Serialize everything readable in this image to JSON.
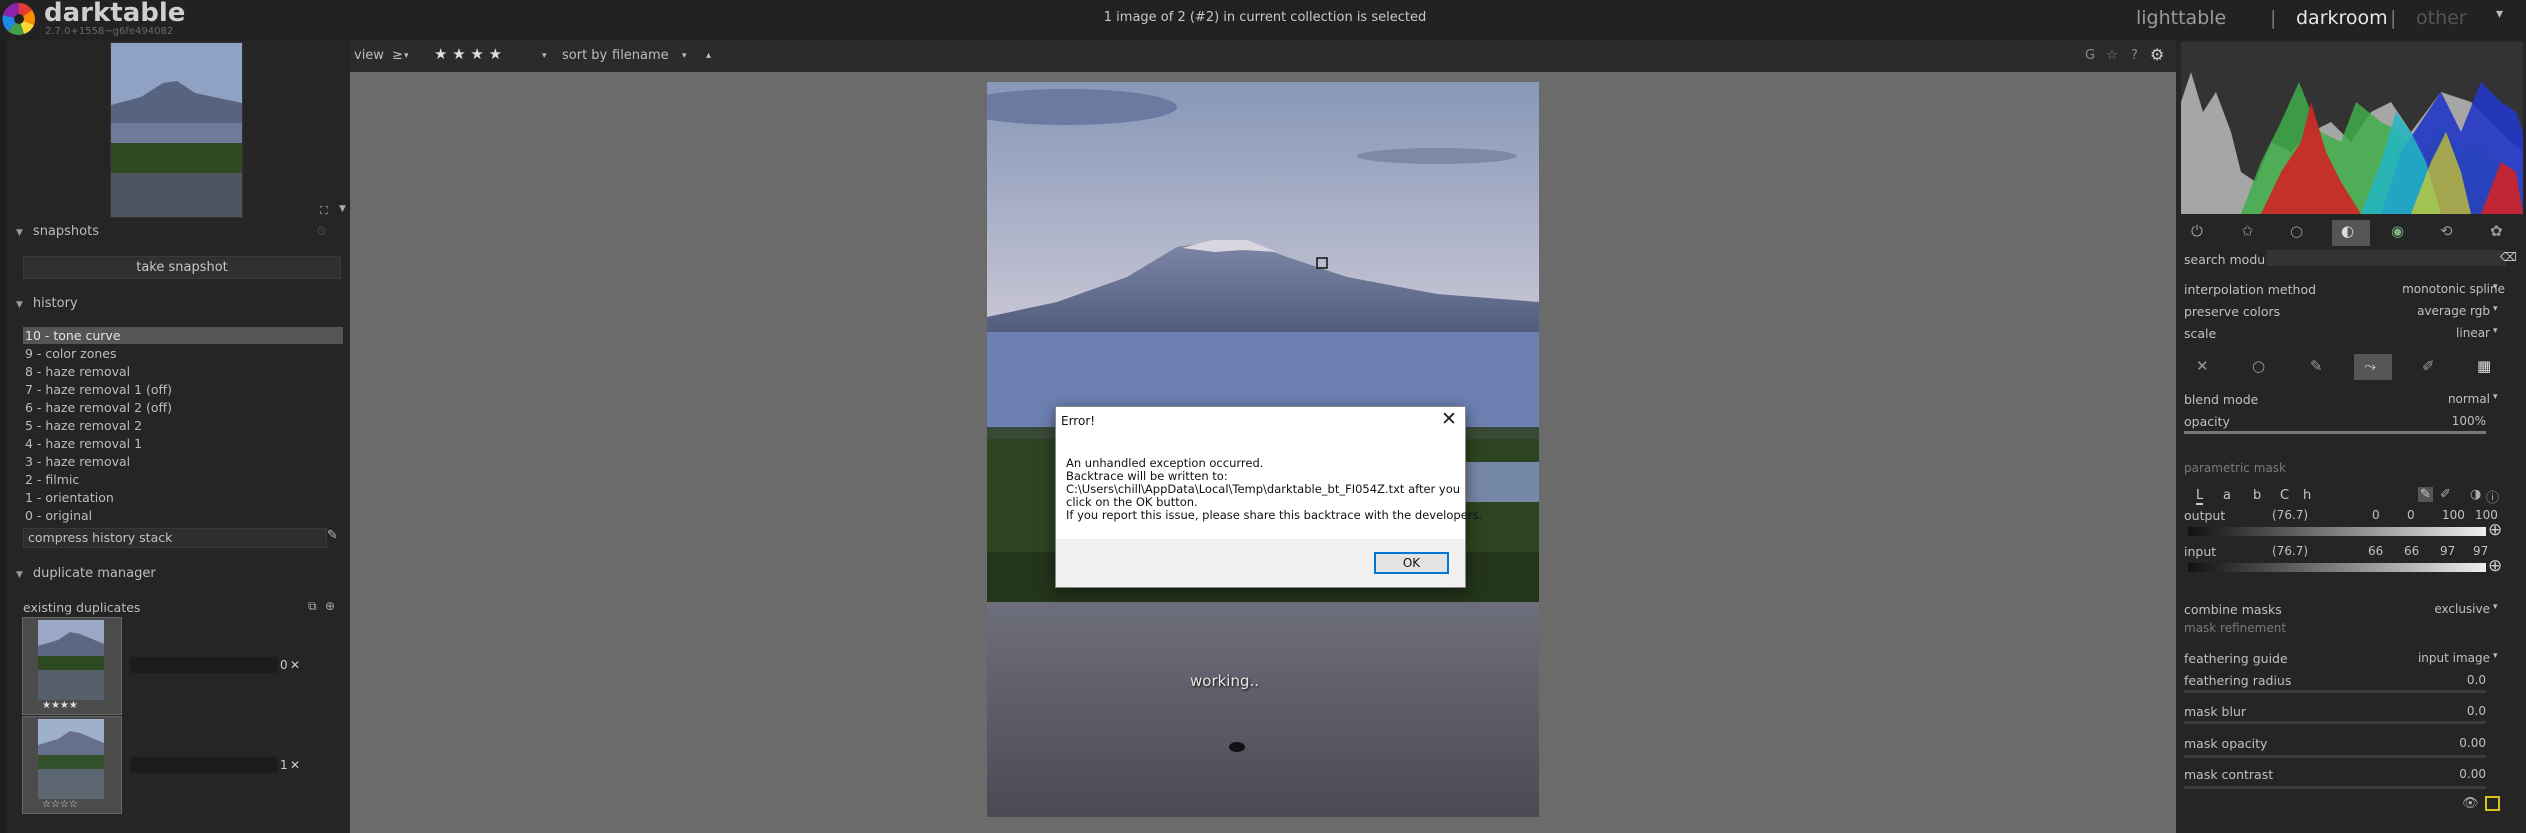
{
  "header": {
    "app_name": "darktable",
    "app_version": "2.7.0+1558~g6fe494082",
    "status": "1 image of 2 (#2) in current collection is selected",
    "views": [
      "lighttable",
      "darkroom",
      "other"
    ],
    "separator": "|",
    "menu_arrow": "▾"
  },
  "left": {
    "snapshots_title": "snapshots",
    "take_snapshot": "take snapshot",
    "history_title": "history",
    "history": [
      "10 - tone curve",
      "9 - color zones",
      "8 - haze removal",
      "7 - haze removal 1 (off)",
      "6 - haze removal 2 (off)",
      "5 - haze removal 2",
      "4 - haze removal 1",
      "3 - haze removal",
      "2 - filmic",
      "1 - orientation",
      "0 - original"
    ],
    "compress": "compress history stack",
    "duplicate_title": "duplicate manager",
    "existing_duplicates": "existing duplicates",
    "dup_numbers": [
      "0",
      "1"
    ],
    "dup_close": "✕",
    "stars": "★★★★",
    "empty_stars": "☆☆☆☆"
  },
  "toolbar": {
    "view_label": "view",
    "view_comparator": "≥",
    "view_stars": "★ ★ ★ ★",
    "sort_label": "sort by",
    "sort_value": "filename",
    "dropdown_arrow": "▾",
    "sort_order": "▴",
    "right_icons": [
      "G",
      "☆",
      "?",
      "⚙"
    ]
  },
  "center": {
    "working": "working.."
  },
  "dialog": {
    "title": "Error!",
    "close": "✕",
    "lines": [
      "An unhandled exception occurred.",
      "Backtrace will be written to:",
      "C:\\Users\\chill\\AppData\\Local\\Temp\\darktable_bt_FI054Z.txt after you",
      "click on the OK button.",
      "If you report this issue, please share this backtrace with the developers."
    ],
    "ok": "OK"
  },
  "right": {
    "search_module": "search module",
    "interpolation_method_label": "interpolation method",
    "interpolation_method_value": "monotonic spline",
    "preserve_colors_label": "preserve colors",
    "preserve_colors_value": "average rgb",
    "scale_label": "scale",
    "scale_value": "linear",
    "blend_mode_label": "blend mode",
    "blend_mode_value": "normal",
    "opacity_label": "opacity",
    "opacity_value": "100%",
    "parametric_mask": "parametric mask",
    "channels": [
      "L",
      "a",
      "b",
      "C",
      "h"
    ],
    "output_label": "output",
    "output_value": "(76.7)",
    "output_nums": [
      "0",
      "0",
      "100",
      "100"
    ],
    "input_label": "input",
    "input_value": "(76.7)",
    "input_nums": [
      "66",
      "66",
      "97",
      "97"
    ],
    "combine_masks_label": "combine masks",
    "combine_masks_value": "exclusive",
    "mask_refinement": "mask refinement",
    "feathering_guide_label": "feathering guide",
    "feathering_guide_value": "input image",
    "feathering_radius_label": "feathering radius",
    "feathering_radius_value": "0.0",
    "mask_blur_label": "mask blur",
    "mask_blur_value": "0.0",
    "mask_opacity_label": "mask opacity",
    "mask_opacity_value": "0.00",
    "mask_contrast_label": "mask contrast",
    "mask_contrast_value": "0.00",
    "dropdown_arrow": "▾"
  }
}
